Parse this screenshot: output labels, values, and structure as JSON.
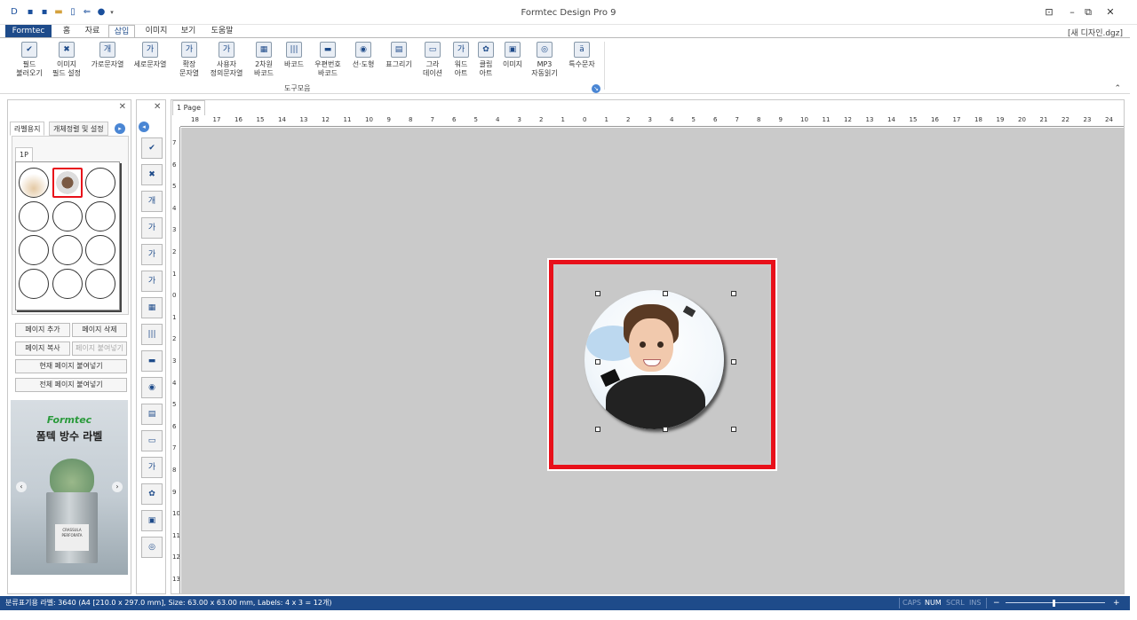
{
  "app": {
    "title": "Formtec Design Pro 9",
    "filename": "[새 디자인.dgz]",
    "quick_access_icons": [
      "new-doc-icon",
      "save-icon",
      "save-as-icon",
      "open-folder-icon",
      "print-preview-icon",
      "undo-icon",
      "circle-icon",
      "dropdown-icon"
    ],
    "window_buttons": [
      "restore-ribbon-icon",
      "minimize-icon",
      "maximize-icon",
      "close-icon"
    ]
  },
  "menu": {
    "brand": "Formtec",
    "tabs": [
      "홈",
      "자료",
      "삽입",
      "이미지",
      "보기",
      "도움말"
    ],
    "active": "삽입"
  },
  "ribbon": {
    "group_label": "도구모음",
    "buttons": [
      {
        "label": "필드\n불러오기",
        "icon": "field-load-icon",
        "glyph": "✔"
      },
      {
        "label": "이미지\n필드 설정",
        "icon": "image-field-icon",
        "glyph": "✖"
      },
      {
        "label": "가로문자열",
        "icon": "horizontal-text-icon",
        "glyph": "개"
      },
      {
        "label": "세로문자열",
        "icon": "vertical-text-icon",
        "glyph": "가"
      },
      {
        "label": "확장\n문자열",
        "icon": "extended-text-icon",
        "glyph": "가"
      },
      {
        "label": "사용자\n정의문자열",
        "icon": "custom-text-icon",
        "glyph": "가"
      },
      {
        "label": "2차원\n바코드",
        "icon": "qr-code-icon",
        "glyph": "▦"
      },
      {
        "label": "바코드",
        "icon": "barcode-icon",
        "glyph": "|||"
      },
      {
        "label": "우편번호\n바코드",
        "icon": "postal-barcode-icon",
        "glyph": "▬"
      },
      {
        "label": "선·도형",
        "icon": "shapes-icon",
        "glyph": "◉"
      },
      {
        "label": "표그리기",
        "icon": "table-icon",
        "glyph": "▤"
      },
      {
        "label": "그라\n데이션",
        "icon": "gradient-icon",
        "glyph": "▭"
      },
      {
        "label": "워드\n아트",
        "icon": "word-art-icon",
        "glyph": "가"
      },
      {
        "label": "클립\n아트",
        "icon": "clip-art-icon",
        "glyph": "✿"
      },
      {
        "label": "이미지",
        "icon": "image-icon",
        "glyph": "▣"
      },
      {
        "label": "MP3\n자동읽기",
        "icon": "mp3-disc-icon",
        "glyph": "◎"
      },
      {
        "label": "특수문자",
        "icon": "special-char-icon",
        "glyph": "ä"
      }
    ]
  },
  "left_panel": {
    "tabs": [
      "라벨용지",
      "개체정렬 및 설정"
    ],
    "page_tab": "1P",
    "buttons": {
      "add_page": "페이지 추가",
      "delete_page": "페이지 삭제",
      "copy_page": "페이지 복사",
      "paste_page": "페이지 붙여넣기",
      "paste_current": "현재 페이지 붙여넣기",
      "paste_all": "전체 페이지 붙여넣기"
    },
    "ad": {
      "brand": "Formtec",
      "title": "폼텍 방수 라벨",
      "pot_label": "CRASSULA PERFORATA"
    }
  },
  "toolbox_icons": [
    "field-load-icon",
    "image-field-icon",
    "horizontal-text-icon",
    "vertical-text-icon",
    "extended-text-icon",
    "custom-text-icon",
    "qr-code-icon",
    "barcode-icon",
    "postal-barcode-icon",
    "shapes-icon",
    "table-icon",
    "gradient-icon",
    "word-art-icon",
    "clip-art-icon",
    "image-icon",
    "mp3-disc-icon"
  ],
  "toolbox_glyphs": [
    "✔",
    "✖",
    "개",
    "가",
    "가",
    "가",
    "▦",
    "|||",
    "▬",
    "◉",
    "▤",
    "▭",
    "가",
    "✿",
    "▣",
    "◎"
  ],
  "document": {
    "page_tab": "1 Page",
    "hruler_numbers": [
      "18",
      "17",
      "16",
      "15",
      "14",
      "13",
      "12",
      "11",
      "10",
      "9",
      "8",
      "7",
      "6",
      "5",
      "4",
      "3",
      "2",
      "1",
      "0",
      "1",
      "2",
      "3",
      "4",
      "5",
      "6",
      "7",
      "8",
      "9",
      "10",
      "11",
      "12",
      "13",
      "14",
      "15",
      "16",
      "17",
      "18",
      "19",
      "20",
      "21",
      "22",
      "23",
      "24"
    ],
    "vruler_numbers": [
      "7",
      "6",
      "5",
      "4",
      "3",
      "2",
      "1",
      "0",
      "1",
      "2",
      "3",
      "4",
      "5",
      "6",
      "7",
      "8",
      "9",
      "10",
      "11",
      "12",
      "13"
    ]
  },
  "status": {
    "text": "분류표기용 라벨: 3640 (A4 [210.0 x 297.0 mm], Size: 63.00 x 63.00 mm,  Labels: 4 x 3 = 12개)",
    "indicators": [
      {
        "label": "CAPS",
        "on": false
      },
      {
        "label": "NUM",
        "on": true
      },
      {
        "label": "SCRL",
        "on": false
      },
      {
        "label": "INS",
        "on": false
      }
    ],
    "zoom_minus": "−",
    "zoom_plus": "+",
    "zoom_level": 0.48
  }
}
